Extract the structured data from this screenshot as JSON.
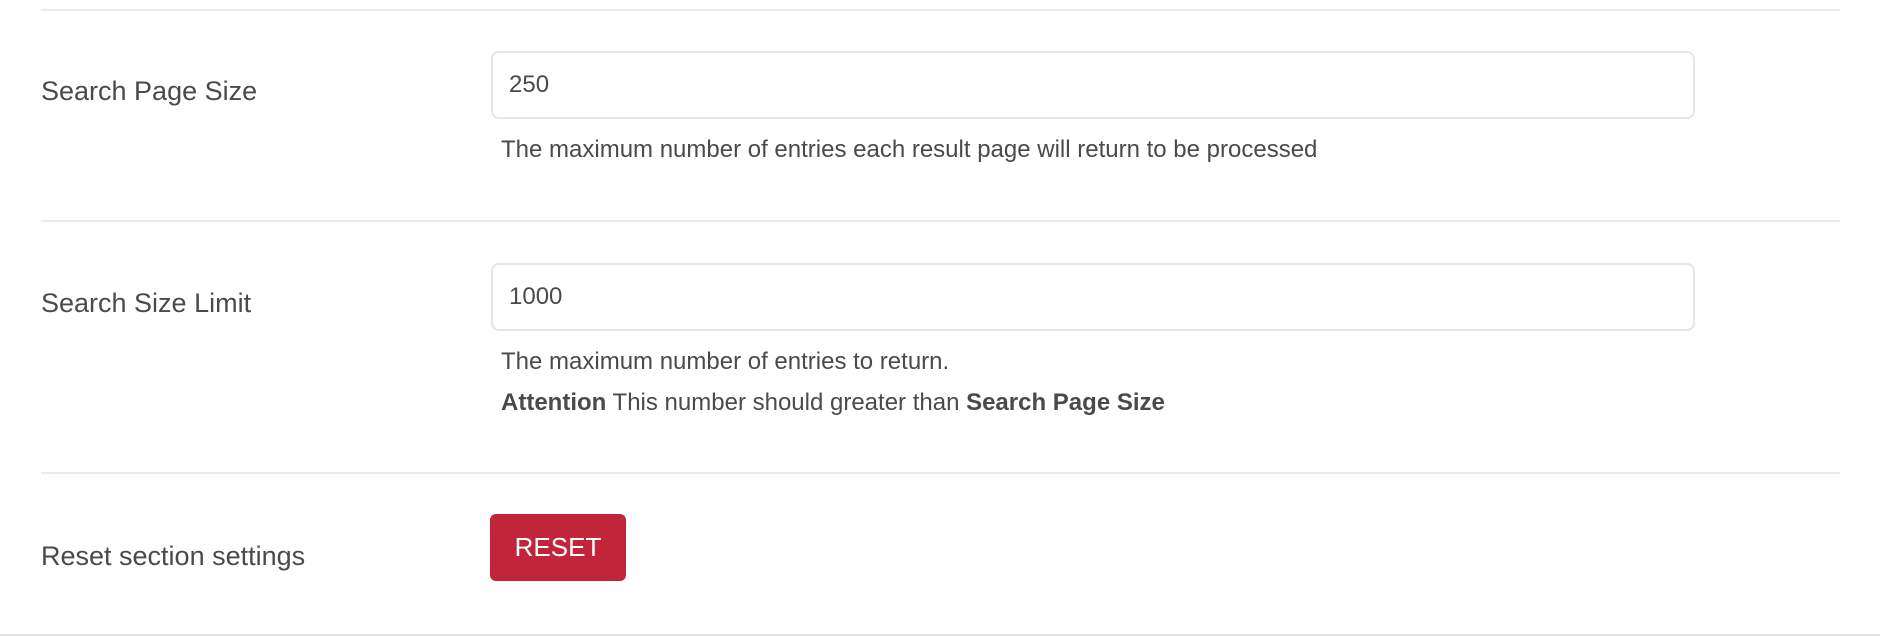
{
  "settings": [
    {
      "label": "Search Page Size",
      "value": "250",
      "help": "The maximum number of entries each result page will return to be processed"
    },
    {
      "label": "Search Size Limit",
      "value": "1000",
      "help": "The maximum number of entries to return.",
      "attention_label": "Attention",
      "attention_text": " This number should greater than ",
      "attention_ref": "Search Page Size"
    }
  ],
  "reset": {
    "label": "Reset section settings",
    "button_label": "RESET"
  },
  "colors": {
    "danger": "#c0253a",
    "text": "#4a4a4a"
  }
}
